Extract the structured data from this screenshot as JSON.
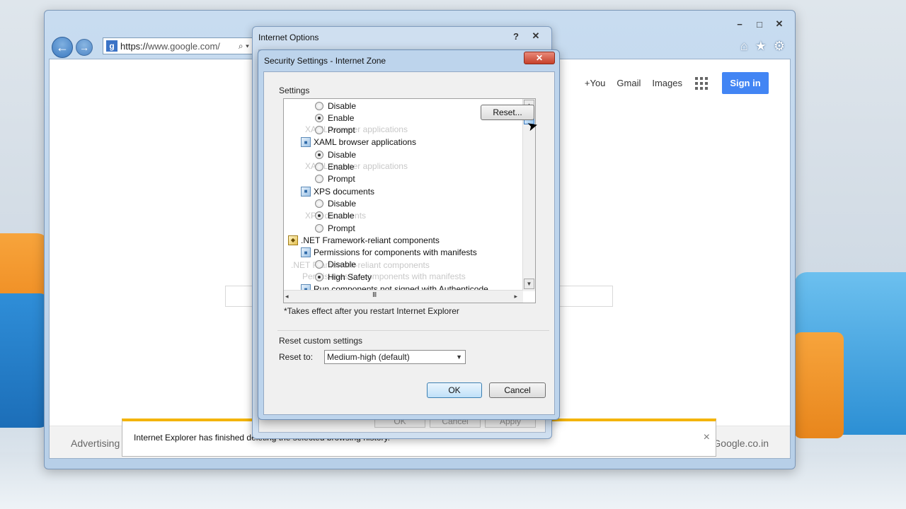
{
  "ie": {
    "address_url_scheme": "https://",
    "address_url_host": "www.google.com/",
    "address_tools": "⌕ ▾",
    "caption_buttons": [
      "−",
      "□",
      "✕"
    ],
    "toolbar_icons": [
      "home-icon",
      "favorites-icon",
      "gear-icon"
    ]
  },
  "google": {
    "links": [
      "+You",
      "Gmail",
      "Images"
    ],
    "signin_label": "Sign in",
    "footer_left": "Advertising",
    "footer_right": "Google.co.in",
    "colors": {
      "signin": "#4285f4",
      "notify_border": "#f4b400"
    }
  },
  "notification": {
    "text": "Internet Explorer has finished deleting the selected browsing history.",
    "close": "×"
  },
  "internet_options": {
    "title": "Internet Options",
    "help": "?",
    "close": "✕",
    "buttons": [
      "OK",
      "Cancel",
      "Apply"
    ]
  },
  "security_settings": {
    "title": "Security Settings - Internet Zone",
    "close": "✕",
    "settings_label": "Settings",
    "rows": [
      {
        "type": "radio",
        "label": "Disable",
        "checked": false
      },
      {
        "type": "radio",
        "label": "Enable",
        "checked": true
      },
      {
        "type": "radio",
        "label": "Prompt",
        "checked": false
      },
      {
        "type": "item",
        "label": "XAML browser applications",
        "icon": "xaml-setting-icon"
      },
      {
        "type": "radio",
        "label": "Disable",
        "checked": true
      },
      {
        "type": "radio",
        "label": "Enable",
        "checked": false
      },
      {
        "type": "radio",
        "label": "Prompt",
        "checked": false
      },
      {
        "type": "item",
        "label": "XPS documents",
        "icon": "xps-setting-icon"
      },
      {
        "type": "radio",
        "label": "Disable",
        "checked": false
      },
      {
        "type": "radio",
        "label": "Enable",
        "checked": true
      },
      {
        "type": "radio",
        "label": "Prompt",
        "checked": false
      },
      {
        "type": "category",
        "label": ".NET Framework-reliant components",
        "icon": "dotnet-category-icon"
      },
      {
        "type": "item",
        "label": "Permissions for components with manifests",
        "icon": "permissions-setting-icon"
      },
      {
        "type": "radio",
        "label": "Disable",
        "checked": false
      },
      {
        "type": "radio",
        "label": "High Safety",
        "checked": true
      },
      {
        "type": "item",
        "label": "Run components not signed with Authenticode",
        "icon": "authenticode-setting-icon"
      }
    ],
    "scroll_arrows": {
      "up": "▲",
      "down": "▼",
      "left": "◂",
      "right": "▸",
      "grip": "III"
    },
    "note": "*Takes effect after you restart Internet Explorer",
    "reset_group_label": "Reset custom settings",
    "reset_to_label": "Reset to:",
    "reset_to_value": "Medium-high (default)",
    "reset_button": "Reset...",
    "ok_button": "OK",
    "cancel_button": "Cancel"
  }
}
